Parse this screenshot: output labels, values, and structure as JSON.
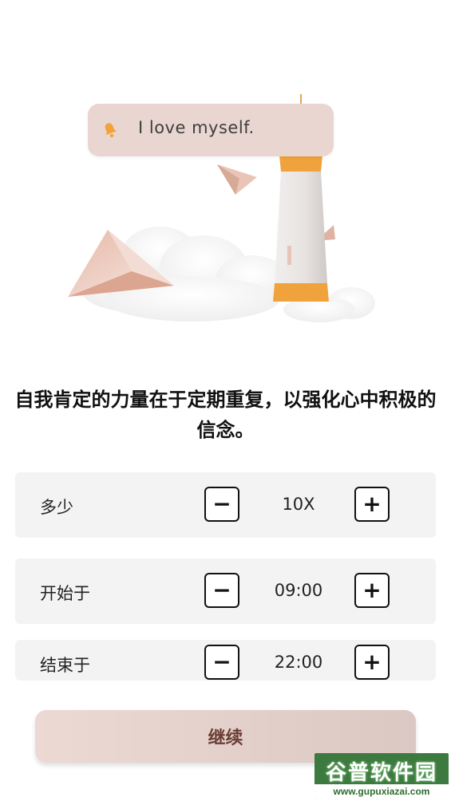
{
  "notification": {
    "text": "I love myself.",
    "icon": "bell-icon"
  },
  "heading": "自我肯定的力量在于定期重复，以强化心中积极的信念。",
  "settings": [
    {
      "label": "多少",
      "value": "10X"
    },
    {
      "label": "开始于",
      "value": "09:00"
    },
    {
      "label": "结束于",
      "value": "22:00"
    }
  ],
  "stepper": {
    "minus": "−",
    "plus": "+"
  },
  "continue_label": "继续",
  "watermark": {
    "top": "谷普软件园",
    "bottom": "www.gupuxiazai.com"
  },
  "colors": {
    "accent": "#ead6d0",
    "button_text": "#6a3e35",
    "lighthouse_band": "#f0a33c"
  }
}
